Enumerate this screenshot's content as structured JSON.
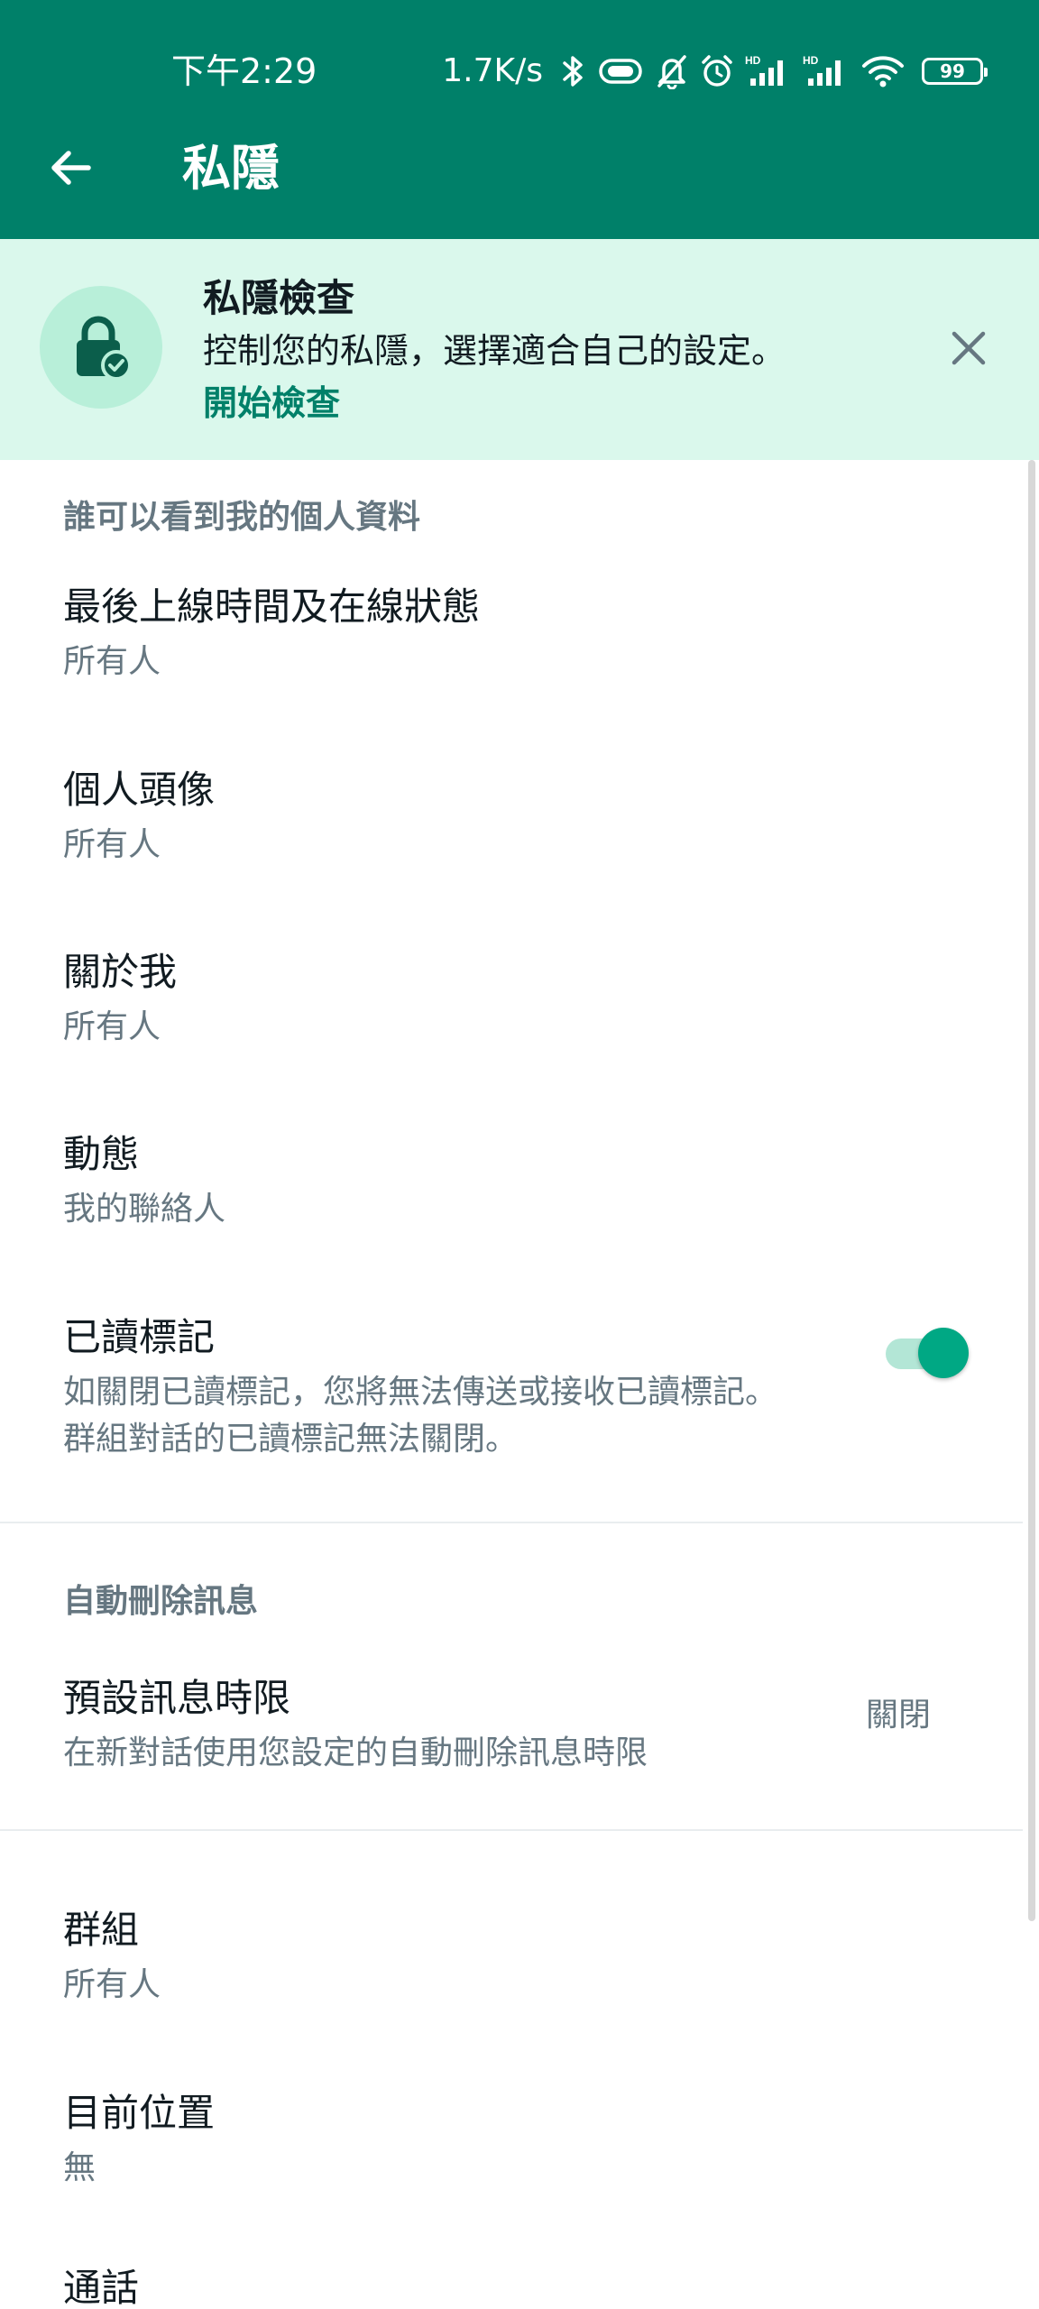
{
  "status_bar": {
    "time": "下午2:29",
    "net_speed": "1.7K/s",
    "battery": "99"
  },
  "app_bar": {
    "title": "私隱",
    "back_icon": "arrow-left-icon",
    "bg_color": "#008069"
  },
  "banner": {
    "title": "私隱檢查",
    "description": "控制您的私隱，選擇適合自己的設定。",
    "link": "開始檢查",
    "icon": "lock-check-icon",
    "close_icon": "close-icon",
    "bg_color": "#daf8ec"
  },
  "sections": {
    "profile_title": "誰可以看到我的個人資料",
    "auto_delete_title": "自動刪除訊息"
  },
  "items": {
    "last_seen": {
      "title": "最後上線時間及在線狀態",
      "value": "所有人"
    },
    "profile_photo": {
      "title": "個人頭像",
      "value": "所有人"
    },
    "about": {
      "title": "關於我",
      "value": "所有人"
    },
    "status": {
      "title": "動態",
      "value": "我的聯絡人"
    },
    "read_receipts": {
      "title": "已讀標記",
      "desc_line1": "如關閉已讀標記，您將無法傳送或接收已讀標記。",
      "desc_line2": "群組對話的已讀標記無法關閉。",
      "enabled": true
    },
    "default_timer": {
      "title": "預設訊息時限",
      "desc": "在新對話使用您設定的自動刪除訊息時限",
      "value": "關閉"
    },
    "groups": {
      "title": "群組",
      "value": "所有人"
    },
    "live_location": {
      "title": "目前位置",
      "value": "無"
    },
    "calls": {
      "title": "通話"
    }
  },
  "accent_color": "#00a884"
}
